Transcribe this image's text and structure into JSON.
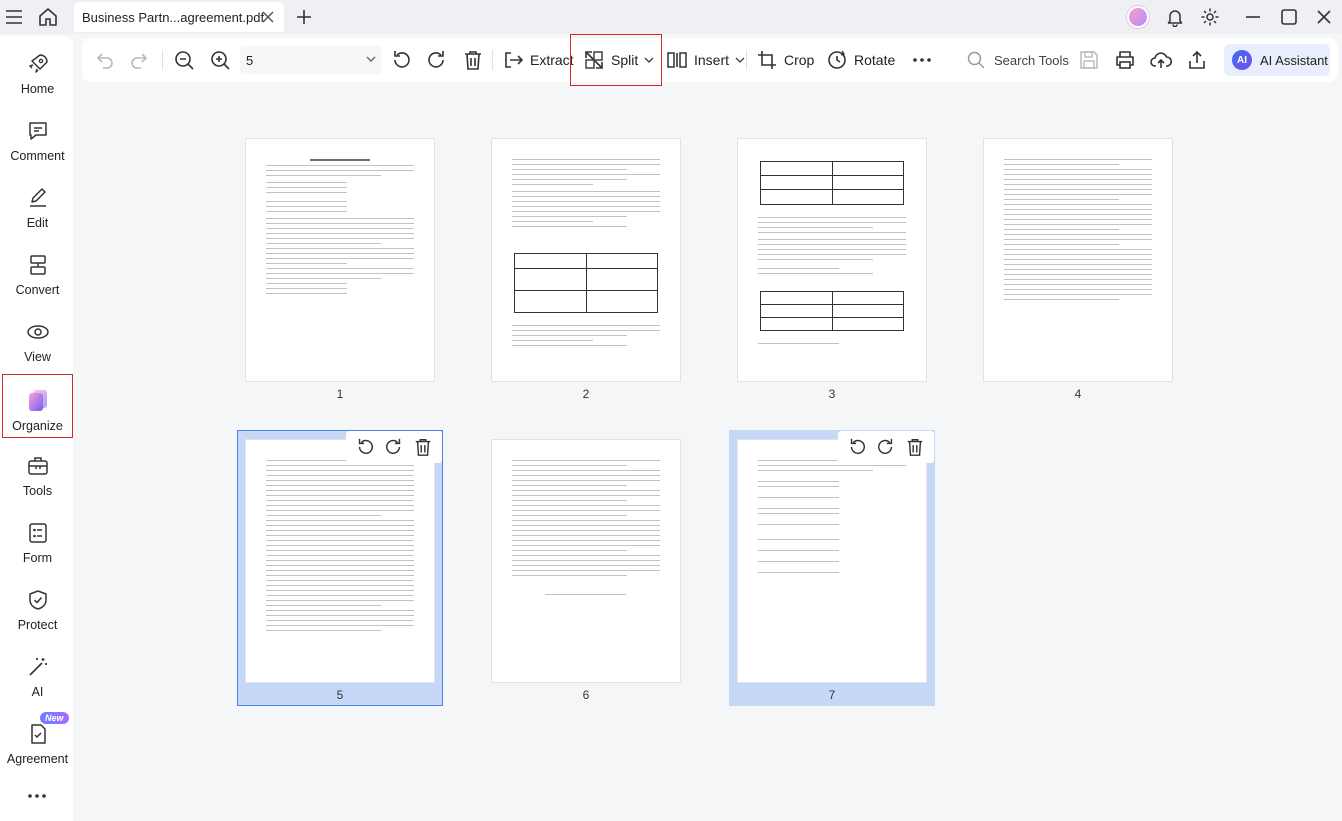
{
  "window": {
    "tab_title": "Business Partn...agreement.pdf"
  },
  "sidebar": {
    "items": [
      {
        "label": "Home",
        "icon": "rocket-icon"
      },
      {
        "label": "Comment",
        "icon": "comment-icon"
      },
      {
        "label": "Edit",
        "icon": "edit-icon"
      },
      {
        "label": "Convert",
        "icon": "convert-icon"
      },
      {
        "label": "View",
        "icon": "view-icon"
      },
      {
        "label": "Organize",
        "icon": "organize-icon",
        "active": true
      },
      {
        "label": "Tools",
        "icon": "toolbox-icon"
      },
      {
        "label": "Form",
        "icon": "form-icon"
      },
      {
        "label": "Protect",
        "icon": "shield-icon"
      },
      {
        "label": "AI",
        "icon": "magic-wand-icon"
      },
      {
        "label": "Agreement",
        "icon": "agreement-icon",
        "badge": "New"
      }
    ]
  },
  "toolbar": {
    "zoom_value": "5",
    "extract": "Extract",
    "split": "Split",
    "insert": "Insert",
    "crop": "Crop",
    "rotate": "Rotate",
    "search_tools": "Search Tools",
    "ai_assistant": "AI Assistant",
    "ai_logo": "AI"
  },
  "pages": [
    {
      "number": "1",
      "selected": false
    },
    {
      "number": "2",
      "selected": false
    },
    {
      "number": "3",
      "selected": false
    },
    {
      "number": "4",
      "selected": false
    },
    {
      "number": "5",
      "selected": true,
      "focused": true
    },
    {
      "number": "6",
      "selected": false
    },
    {
      "number": "7",
      "selected": true,
      "focused": false
    }
  ],
  "colors": {
    "highlight_red": "#d6292e",
    "selection_blue": "#c6d8f7",
    "selection_border": "#4b82e6",
    "ai_accent": "#3a6df0"
  }
}
